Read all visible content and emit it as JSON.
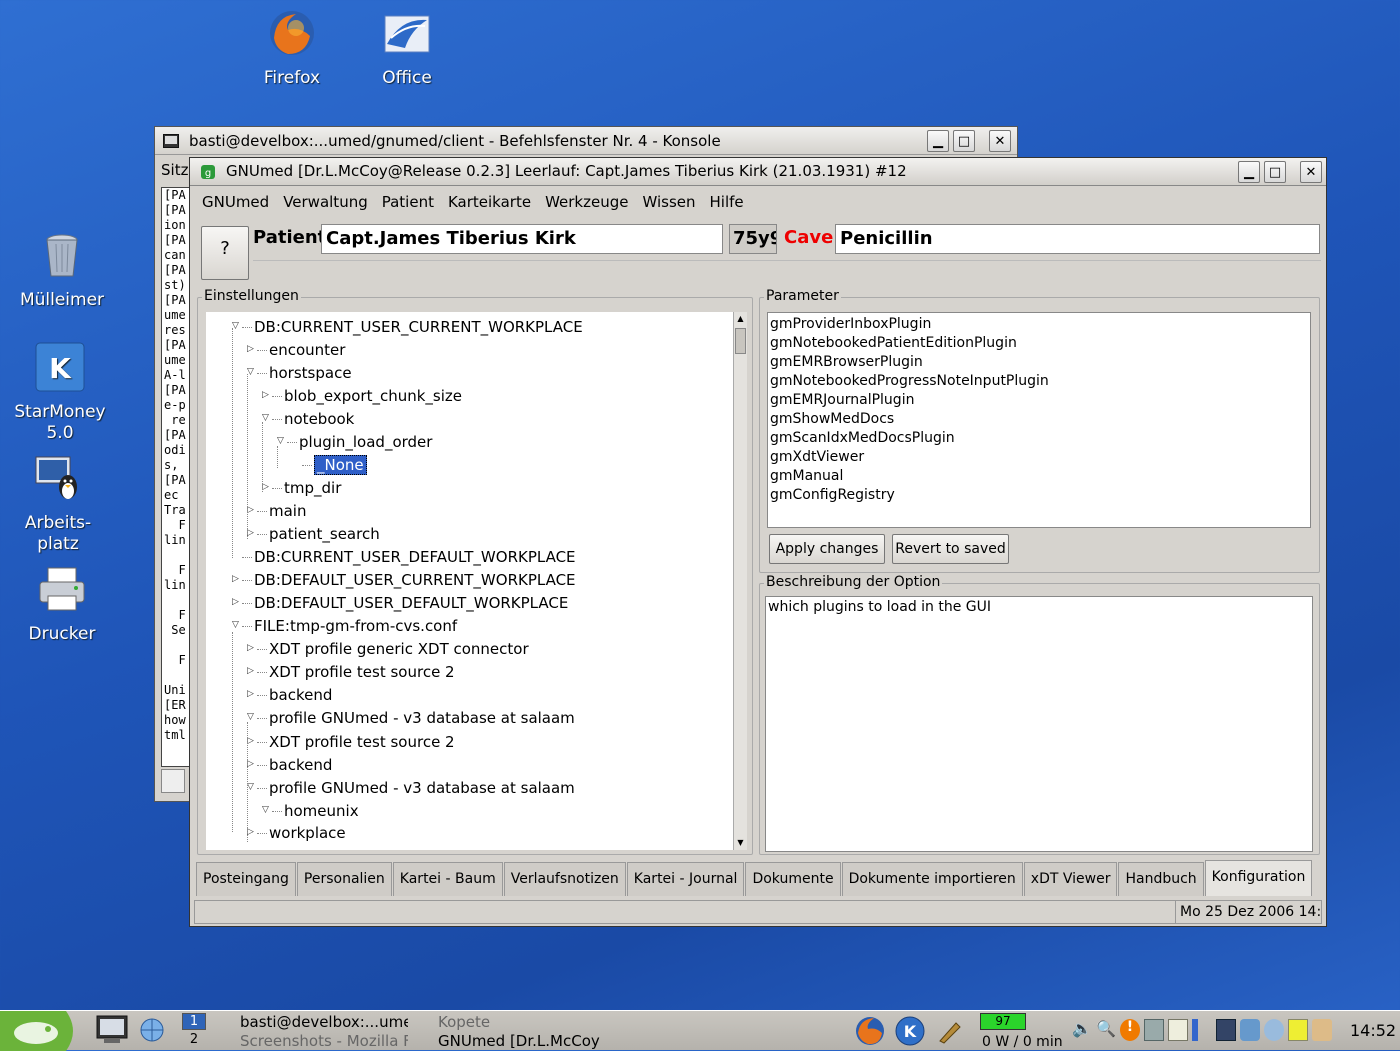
{
  "desktop": {
    "icons": [
      {
        "label": "Firefox"
      },
      {
        "label": "Office"
      },
      {
        "label": "Mülleimer"
      },
      {
        "label_line1": "StarMoney",
        "label_line2": "5.0"
      },
      {
        "label_line1": "Arbeits-",
        "label_line2": "platz"
      },
      {
        "label": "Drucker"
      }
    ]
  },
  "konsole": {
    "title": "basti@develbox:...umed/gnumed/client - Befehlsfenster Nr. 4 - Konsole",
    "menu_fragment": "Sitz",
    "terminal_text": "[PA\n[PA\nion\n[PA\ncan\n[PA\nst)\n[PA\nume\nres\n[PA\nume\nA-l\n[PA\ne-p\n re\n[PA\nodi\ns,\n[PA\nec\nTra\n  F\nlin\n\n  F\nlin\n\n  F\n Se\n\n  F\n\nUni\n[ER\nhow\ntml"
  },
  "gnumed": {
    "title": "GNUmed [Dr.L.McCoy@Release 0.2.3] Leerlauf: Capt.James Tiberius Kirk (21.03.1931) #12",
    "menu": [
      "GNUmed",
      "Verwaltung",
      "Patient",
      "Karteikarte",
      "Werkzeuge",
      "Wissen",
      "Hilfe"
    ],
    "help_button": "?",
    "patient_label": "Patient",
    "patient_name": "Capt.James Tiberius Kirk",
    "age": "75y9",
    "cave_label": "Cave",
    "cave_value": "Penicillin",
    "settings_group": "Einstellungen",
    "tree": [
      "DB:CURRENT_USER_CURRENT_WORKPLACE",
      "encounter",
      "horstspace",
      "blob_export_chunk_size",
      "notebook",
      "plugin_load_order",
      "_None",
      "tmp_dir",
      "main",
      "patient_search",
      "DB:CURRENT_USER_DEFAULT_WORKPLACE",
      "DB:DEFAULT_USER_CURRENT_WORKPLACE",
      "DB:DEFAULT_USER_DEFAULT_WORKPLACE",
      "FILE:tmp-gm-from-cvs.conf",
      "XDT profile generic XDT connector",
      "XDT profile test source 2",
      "backend",
      "profile GNUmed - v3 database at salaam",
      "XDT profile test source 2",
      "backend",
      "profile GNUmed - v3 database at salaam",
      "homeunix",
      "workplace"
    ],
    "parameter_group": "Parameter",
    "parameters": [
      "gmProviderInboxPlugin",
      "gmNotebookedPatientEditionPlugin",
      "gmEMRBrowserPlugin",
      "gmNotebookedProgressNoteInputPlugin",
      "gmEMRJournalPlugin",
      "gmShowMedDocs",
      "gmScanIdxMedDocsPlugin",
      "gmXdtViewer",
      "gmManual",
      "gmConfigRegistry"
    ],
    "apply_button": "Apply changes",
    "revert_button": "Revert to saved",
    "description_group": "Beschreibung der Option",
    "description": "which plugins to load in the GUI",
    "tabs": [
      "Posteingang",
      "Personalien",
      "Kartei - Baum",
      "Verlaufsnotizen",
      "Kartei - Journal",
      "Dokumente",
      "Dokumente importieren",
      "xDT Viewer",
      "Handbuch",
      "Konfiguration"
    ],
    "active_tab": "Konfiguration",
    "status_clock": "Mo 25 Dez 2006 14:"
  },
  "taskbar": {
    "desktop_numbers": [
      "1",
      "2"
    ],
    "tasks": [
      "basti@develbox:...umed/",
      "Kopete",
      "Screenshots - Mozilla Fi",
      "GNUmed [Dr.L.McCoy"
    ],
    "battery": "97",
    "power": "0 W / 0 min",
    "clock": "14:52"
  }
}
